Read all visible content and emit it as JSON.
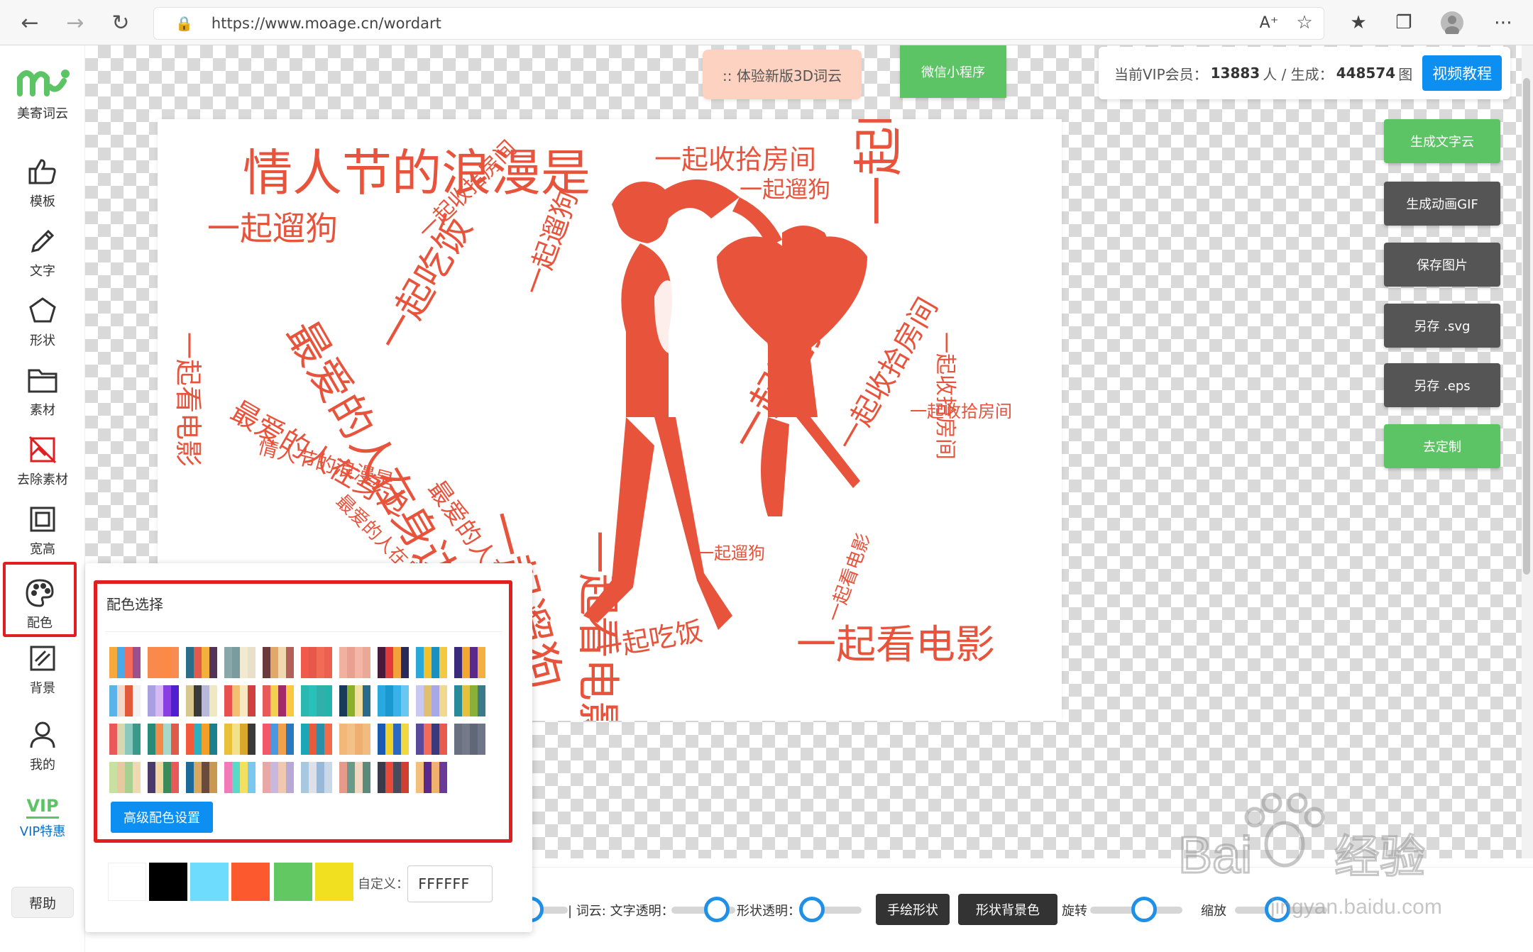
{
  "browser": {
    "url": "https://www.moage.cn/wordart"
  },
  "app": {
    "logo_text": "美寄词云",
    "brand_color": "#5cc464",
    "accent_color": "#0d8ff2"
  },
  "sidebar": {
    "items": [
      {
        "label": "模板",
        "icon": "thumbs-up-icon"
      },
      {
        "label": "文字",
        "icon": "pencil-icon"
      },
      {
        "label": "形状",
        "icon": "pentagon-icon"
      },
      {
        "label": "素材",
        "icon": "folder-icon"
      },
      {
        "label": "去除素材",
        "icon": "remove-image-icon"
      },
      {
        "label": "宽高",
        "icon": "frame-icon"
      },
      {
        "label": "配色",
        "icon": "palette-icon"
      },
      {
        "label": "背景",
        "icon": "background-icon"
      },
      {
        "label": "我的",
        "icon": "user-icon"
      },
      {
        "label": "VIP特惠",
        "icon": "vip-icon",
        "icon_text": "VIP"
      }
    ],
    "help": "帮助"
  },
  "top": {
    "btn_3d": ":: 体验新版3D词云",
    "btn_wechat": "微信小程序",
    "vip_prefix": "当前VIP会员：",
    "vip_count": "13883",
    "vip_mid": "人 / 生成：",
    "gen_count": "448574",
    "gen_suffix": "图",
    "video_btn": "视频教程"
  },
  "right_buttons": [
    {
      "label": "生成文字云",
      "style": "green"
    },
    {
      "label": "生成动画GIF",
      "style": "grey"
    },
    {
      "label": "保存图片",
      "style": "grey"
    },
    {
      "label": "另存 .svg",
      "style": "grey"
    },
    {
      "label": "另存 .eps",
      "style": "grey"
    },
    {
      "label": "去定制",
      "style": "green"
    }
  ],
  "cloud": {
    "color": "#e8533c",
    "words": [
      "情人节的浪漫是",
      "一起收拾房间",
      "一起遛狗",
      "最爱的人在身边",
      "一起看电影",
      "一起吃饭",
      "最爱的人在身边",
      "一起吃饭",
      "一起遛狗",
      "一起收拾房间",
      "一起看电影",
      "一起吃饭",
      "一起遛狗",
      "一起看电影",
      "一起遛狗",
      "一起收拾房间",
      "最爱的人在身边",
      "一起吃饭",
      "一起遛狗",
      "一起看电影",
      "一起收拾房间",
      "最爱的人在身边"
    ]
  },
  "palette_popup": {
    "title": "配色选择",
    "advanced": "高级配色设置",
    "custom_label": "自定义：",
    "custom_value": "FFFFFF",
    "solids": [
      "#ffffff",
      "#000000",
      "#6edcfc",
      "#fc5a2e",
      "#62c962",
      "#f0e020"
    ],
    "schemes": [
      [
        "#f4a93a",
        "#4aa9e8",
        "#f46d5a",
        "#9b4f8f"
      ],
      [
        "#f88a4e",
        "#f98a4a",
        "#fa8a46",
        "#f88c52"
      ],
      [
        "#2a6e8a",
        "#e25a4a",
        "#f2b13c",
        "#54335a"
      ],
      [
        "#8aa8a8",
        "#7a9ca0",
        "#f2ead0",
        "#e8e0c8"
      ],
      [
        "#6a3a3a",
        "#e2a86a",
        "#f2d8b0",
        "#b4605a"
      ],
      [
        "#f05a4a",
        "#e8584a",
        "#f26b54",
        "#ec6050"
      ],
      [
        "#f2b0a0",
        "#e8a090",
        "#f4b4a6",
        "#eaa898"
      ],
      [
        "#4a1a3a",
        "#e23a3a",
        "#f2a43a",
        "#2a2a5a"
      ],
      [
        "#2aa8d8",
        "#f2c02a",
        "#1a90c0",
        "#f4c840"
      ],
      [
        "#3a2a7a",
        "#f2a830",
        "#5a2a8a",
        "#f4b040"
      ],
      [
        "#5ab4e8",
        "#f2d8c8",
        "#e25a3a",
        "#f2f2f2"
      ],
      [
        "#a8a0e0",
        "#d8b8f0",
        "#8a40e0",
        "#5020d0"
      ],
      [
        "#d8c890",
        "#3a3a3a",
        "#b8b8d8",
        "#f0e8c0"
      ],
      [
        "#e85050",
        "#f2c070",
        "#f8e8c0",
        "#d04040"
      ],
      [
        "#e85a5a",
        "#f2d050",
        "#a02a6a",
        "#f8c840"
      ],
      [
        "#2ab8b0",
        "#28c0b8",
        "#30b0a8",
        "#24b4ac"
      ],
      [
        "#1a3a5a",
        "#8ab02a",
        "#f2e0a0",
        "#2a6a8a"
      ],
      [
        "#2aa8e0",
        "#1a98d0",
        "#38b0e8",
        "#6ac8f0"
      ],
      [
        "#c8c8f0",
        "#e0c070",
        "#a8a8e8",
        "#f0d890"
      ],
      [
        "#2a8a9a",
        "#e8c040",
        "#8ab03a",
        "#3a7a8a"
      ],
      [
        "#e85a5a",
        "#d8d8b0",
        "#8ac8c0",
        "#3a9a8a"
      ],
      [
        "#2a8a7a",
        "#f28a4a",
        "#a8d8c8",
        "#e05a4a"
      ],
      [
        "#f25a3a",
        "#2ab0c0",
        "#f2a02a",
        "#1a8090"
      ],
      [
        "#e8c03a",
        "#f2e08a",
        "#d8a82a",
        "#3a3a3a"
      ],
      [
        "#f2586a",
        "#4a98e0",
        "#f2a04a",
        "#2a78c0"
      ],
      [
        "#1aa8b8",
        "#e85a3a",
        "#2a90a8",
        "#f26a4a"
      ],
      [
        "#f2b87a",
        "#f4c08a",
        "#eeb070",
        "#f2bc80"
      ],
      [
        "#1a5ab0",
        "#f2d02a",
        "#2a6ac0",
        "#f2d840"
      ],
      [
        "#5a4a9a",
        "#f26a5a",
        "#3a3a7a",
        "#e85a4a"
      ],
      [
        "#6a7080",
        "#747a8a",
        "#606878",
        "#70768a"
      ],
      [
        "#c8e0a0",
        "#e8c8a0",
        "#a8d090",
        "#f0d8b0"
      ],
      [
        "#4a3a6a",
        "#f2d8a0",
        "#3a8a5a",
        "#e85a5a"
      ],
      [
        "#1a6a9a",
        "#d8a860",
        "#6a4a3a",
        "#c89a50"
      ],
      [
        "#f27ab8",
        "#5ad8c8",
        "#f2e060",
        "#7ac8f0"
      ],
      [
        "#e8a8a8",
        "#c8b8e0",
        "#f0c8b0",
        "#b8a8d8"
      ],
      [
        "#a8c8e0",
        "#e0e0e8",
        "#98b8d8",
        "#c8d8e8"
      ],
      [
        "#e89a8a",
        "#6a9a8a",
        "#f2d8c0",
        "#5a8a7a"
      ],
      [
        "#3a3a4a",
        "#e84a3a",
        "#4a4a5a",
        "#d04030"
      ],
      [
        "#f2c07a",
        "#5a2a8a",
        "#f0b070",
        "#6a3a9a"
      ]
    ]
  },
  "bottom_bar": {
    "label_wordcloud": "| 词云: 文字透明：",
    "label_shape_opacity": "形状透明：",
    "btn_draw_shape": "手绘形状",
    "btn_shape_bg": "形状背景色",
    "label_rotate": "旋转",
    "label_zoom": "缩放"
  },
  "watermark": {
    "text_left": "Bai",
    "text_right": "经验",
    "url": "jingyan.baidu.com"
  }
}
